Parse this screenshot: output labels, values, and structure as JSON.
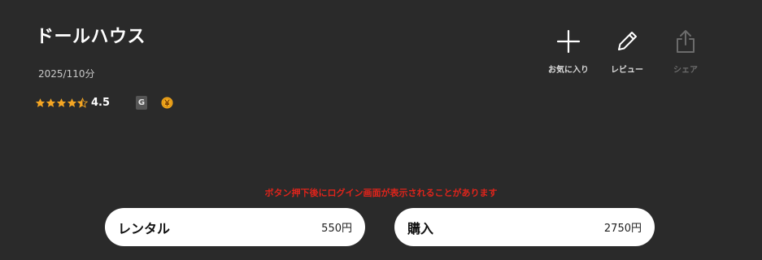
{
  "movie": {
    "title": "ドールハウス",
    "meta": "2025/110分",
    "rating": "4.5",
    "rating_stars": 4.5,
    "age_badge": "G",
    "price_badge_icon": "yen-coin-icon"
  },
  "actions": [
    {
      "label": "お気に入り",
      "icon": "plus-icon",
      "enabled": true
    },
    {
      "label": "レビュー",
      "icon": "pencil-icon",
      "enabled": true
    },
    {
      "label": "シェア",
      "icon": "share-icon",
      "enabled": false
    }
  ],
  "notice": "ボタン押下後にログイン画面が表示されることがあります",
  "purchase": {
    "rental": {
      "label": "レンタル",
      "price": "550円"
    },
    "buy": {
      "label": "購入",
      "price": "2750円"
    }
  },
  "colors": {
    "background": "#2a2a2a",
    "star": "#f5a623",
    "notice": "#e0241b",
    "button_bg": "#ffffff"
  }
}
